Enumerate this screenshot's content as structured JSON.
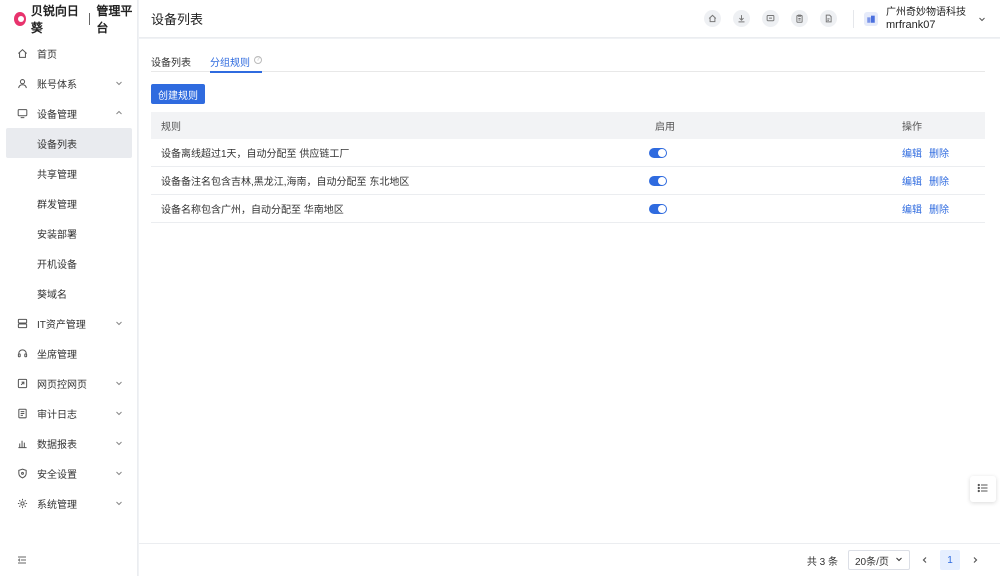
{
  "brand": {
    "name": "贝锐向日葵",
    "sub": "管理平台"
  },
  "sidebar": {
    "items": [
      {
        "label": "首页",
        "icon": "home-icon"
      },
      {
        "label": "账号体系",
        "icon": "user-icon",
        "expandable": true
      },
      {
        "label": "设备管理",
        "icon": "monitor-icon",
        "expanded": true
      },
      {
        "label": "IT资产管理",
        "icon": "server-icon",
        "expandable": true
      },
      {
        "label": "坐席管理",
        "icon": "headset-icon"
      },
      {
        "label": "网页控网页",
        "icon": "web-control-icon",
        "expandable": true
      },
      {
        "label": "审计日志",
        "icon": "log-icon",
        "expandable": true
      },
      {
        "label": "数据报表",
        "icon": "chart-icon",
        "expandable": true
      },
      {
        "label": "安全设置",
        "icon": "shield-icon",
        "expandable": true
      },
      {
        "label": "系统管理",
        "icon": "gear-icon",
        "expandable": true
      }
    ],
    "device_sub": [
      "设备列表",
      "共享管理",
      "群发管理",
      "安装部署",
      "开机设备",
      "葵域名"
    ],
    "active_sub": "设备列表"
  },
  "header": {
    "title": "设备列表",
    "org": "广州奇妙物语科技",
    "user": "mrfrank07"
  },
  "tabs": [
    {
      "label": "设备列表",
      "active": false
    },
    {
      "label": "分组规则",
      "active": true
    }
  ],
  "toolbar": {
    "create_label": "创建规则"
  },
  "table": {
    "columns": [
      "规则",
      "启用",
      "操作"
    ],
    "rows": [
      {
        "rule": "设备离线超过1天，自动分配至 供应链工厂",
        "enabled": true
      },
      {
        "rule": "设备备注名包含吉林,黑龙江,海南，自动分配至 东北地区",
        "enabled": true
      },
      {
        "rule": "设备名称包含广州，自动分配至 华南地区",
        "enabled": true
      }
    ],
    "edit_label": "编辑",
    "delete_label": "删除"
  },
  "pagination": {
    "total": "共 3 条",
    "page_size": "20条/页",
    "current": "1"
  },
  "colors": {
    "accent": "#2f6bdf",
    "brand": "#e8336d"
  }
}
